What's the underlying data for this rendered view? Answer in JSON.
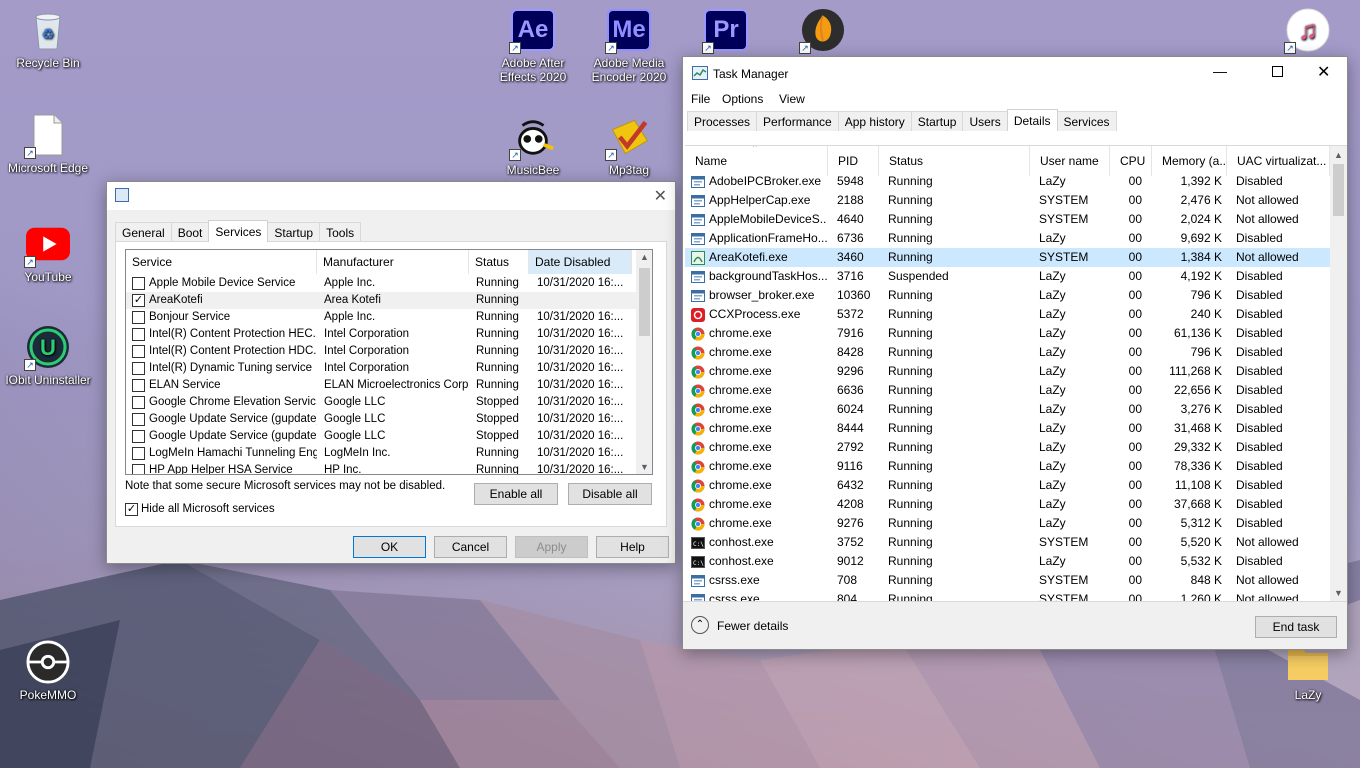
{
  "desktop": {
    "icons": [
      {
        "label": "Recycle Bin"
      },
      {
        "label": "Microsoft Edge"
      },
      {
        "label": "YouTube"
      },
      {
        "label": "IObit Uninstaller"
      },
      {
        "label": "PokeMMO"
      },
      {
        "label": "Adobe After Effects 2020",
        "glyph": "Ae"
      },
      {
        "label": "Adobe Media Encoder 2020",
        "glyph": "Me"
      },
      {
        "label": "Pr",
        "glyph": "Pr"
      },
      {
        "label": "MusicBee"
      },
      {
        "label": "Mp3tag"
      },
      {
        "label": "LaZy"
      }
    ]
  },
  "msconfig": {
    "tabs": [
      "General",
      "Boot",
      "Services",
      "Startup",
      "Tools"
    ],
    "active_tab": "Services",
    "columns": [
      "Service",
      "Manufacturer",
      "Status",
      "Date Disabled"
    ],
    "rows": [
      {
        "service": "Apple Mobile Device Service",
        "manufacturer": "Apple Inc.",
        "status": "Running",
        "date": "10/31/2020 16:...",
        "checked": false
      },
      {
        "service": "AreaKotefi",
        "manufacturer": "Area Kotefi",
        "status": "Running",
        "date": "",
        "checked": true
      },
      {
        "service": "Bonjour Service",
        "manufacturer": "Apple Inc.",
        "status": "Running",
        "date": "10/31/2020 16:...",
        "checked": false
      },
      {
        "service": "Intel(R) Content Protection HEC...",
        "manufacturer": "Intel Corporation",
        "status": "Running",
        "date": "10/31/2020 16:...",
        "checked": false
      },
      {
        "service": "Intel(R) Content Protection HDC...",
        "manufacturer": "Intel Corporation",
        "status": "Running",
        "date": "10/31/2020 16:...",
        "checked": false
      },
      {
        "service": "Intel(R) Dynamic Tuning service",
        "manufacturer": "Intel Corporation",
        "status": "Running",
        "date": "10/31/2020 16:...",
        "checked": false
      },
      {
        "service": "ELAN Service",
        "manufacturer": "ELAN Microelectronics Corp.",
        "status": "Running",
        "date": "10/31/2020 16:...",
        "checked": false
      },
      {
        "service": "Google Chrome Elevation Servic...",
        "manufacturer": "Google LLC",
        "status": "Stopped",
        "date": "10/31/2020 16:...",
        "checked": false
      },
      {
        "service": "Google Update Service (gupdate)",
        "manufacturer": "Google LLC",
        "status": "Stopped",
        "date": "10/31/2020 16:...",
        "checked": false
      },
      {
        "service": "Google Update Service (gupdatem)",
        "manufacturer": "Google LLC",
        "status": "Stopped",
        "date": "10/31/2020 16:...",
        "checked": false
      },
      {
        "service": "LogMeIn Hamachi Tunneling Engine",
        "manufacturer": "LogMeIn Inc.",
        "status": "Running",
        "date": "10/31/2020 16:...",
        "checked": false
      },
      {
        "service": "HP App Helper HSA Service",
        "manufacturer": "HP Inc.",
        "status": "Running",
        "date": "10/31/2020 16:...",
        "checked": false
      }
    ],
    "note": "Note that some secure Microsoft services may not be disabled.",
    "enable_all": "Enable all",
    "disable_all": "Disable all",
    "hide_ms_label": "Hide all Microsoft services",
    "hide_ms_checked": true,
    "ok": "OK",
    "cancel": "Cancel",
    "apply": "Apply",
    "help": "Help"
  },
  "task_manager": {
    "title": "Task Manager",
    "menu": [
      "File",
      "Options",
      "View"
    ],
    "tabs": [
      "Processes",
      "Performance",
      "App history",
      "Startup",
      "Users",
      "Details",
      "Services"
    ],
    "active_tab": "Details",
    "columns": [
      "Name",
      "PID",
      "Status",
      "User name",
      "CPU",
      "Memory (a...",
      "UAC virtualizat..."
    ],
    "rows": [
      {
        "name": "AdobeIPCBroker.exe",
        "pid": "5948",
        "status": "Running",
        "user": "LaZy",
        "cpu": "00",
        "mem": "1,392 K",
        "uac": "Disabled",
        "icon": "window-icon"
      },
      {
        "name": "AppHelperCap.exe",
        "pid": "2188",
        "status": "Running",
        "user": "SYSTEM",
        "cpu": "00",
        "mem": "2,476 K",
        "uac": "Not allowed",
        "icon": "window-icon"
      },
      {
        "name": "AppleMobileDeviceS...",
        "pid": "4640",
        "status": "Running",
        "user": "SYSTEM",
        "cpu": "00",
        "mem": "2,024 K",
        "uac": "Not allowed",
        "icon": "window-icon"
      },
      {
        "name": "ApplicationFrameHo...",
        "pid": "6736",
        "status": "Running",
        "user": "LaZy",
        "cpu": "00",
        "mem": "9,692 K",
        "uac": "Disabled",
        "icon": "window-icon"
      },
      {
        "name": "AreaKotefi.exe",
        "pid": "3460",
        "status": "Running",
        "user": "SYSTEM",
        "cpu": "00",
        "mem": "1,384 K",
        "uac": "Not allowed",
        "icon": "areakotefi-icon",
        "selected": true
      },
      {
        "name": "backgroundTaskHos...",
        "pid": "3716",
        "status": "Suspended",
        "user": "LaZy",
        "cpu": "00",
        "mem": "4,192 K",
        "uac": "Disabled",
        "icon": "window-icon"
      },
      {
        "name": "browser_broker.exe",
        "pid": "10360",
        "status": "Running",
        "user": "LaZy",
        "cpu": "00",
        "mem": "796 K",
        "uac": "Disabled",
        "icon": "window-icon"
      },
      {
        "name": "CCXProcess.exe",
        "pid": "5372",
        "status": "Running",
        "user": "LaZy",
        "cpu": "00",
        "mem": "240 K",
        "uac": "Disabled",
        "icon": "creative-cloud-icon"
      },
      {
        "name": "chrome.exe",
        "pid": "7916",
        "status": "Running",
        "user": "LaZy",
        "cpu": "00",
        "mem": "61,136 K",
        "uac": "Disabled",
        "icon": "chrome-icon"
      },
      {
        "name": "chrome.exe",
        "pid": "8428",
        "status": "Running",
        "user": "LaZy",
        "cpu": "00",
        "mem": "796 K",
        "uac": "Disabled",
        "icon": "chrome-icon"
      },
      {
        "name": "chrome.exe",
        "pid": "9296",
        "status": "Running",
        "user": "LaZy",
        "cpu": "00",
        "mem": "111,268 K",
        "uac": "Disabled",
        "icon": "chrome-icon"
      },
      {
        "name": "chrome.exe",
        "pid": "6636",
        "status": "Running",
        "user": "LaZy",
        "cpu": "00",
        "mem": "22,656 K",
        "uac": "Disabled",
        "icon": "chrome-icon"
      },
      {
        "name": "chrome.exe",
        "pid": "6024",
        "status": "Running",
        "user": "LaZy",
        "cpu": "00",
        "mem": "3,276 K",
        "uac": "Disabled",
        "icon": "chrome-icon"
      },
      {
        "name": "chrome.exe",
        "pid": "8444",
        "status": "Running",
        "user": "LaZy",
        "cpu": "00",
        "mem": "31,468 K",
        "uac": "Disabled",
        "icon": "chrome-icon"
      },
      {
        "name": "chrome.exe",
        "pid": "2792",
        "status": "Running",
        "user": "LaZy",
        "cpu": "00",
        "mem": "29,332 K",
        "uac": "Disabled",
        "icon": "chrome-icon"
      },
      {
        "name": "chrome.exe",
        "pid": "9116",
        "status": "Running",
        "user": "LaZy",
        "cpu": "00",
        "mem": "78,336 K",
        "uac": "Disabled",
        "icon": "chrome-icon"
      },
      {
        "name": "chrome.exe",
        "pid": "6432",
        "status": "Running",
        "user": "LaZy",
        "cpu": "00",
        "mem": "11,108 K",
        "uac": "Disabled",
        "icon": "chrome-icon"
      },
      {
        "name": "chrome.exe",
        "pid": "4208",
        "status": "Running",
        "user": "LaZy",
        "cpu": "00",
        "mem": "37,668 K",
        "uac": "Disabled",
        "icon": "chrome-icon"
      },
      {
        "name": "chrome.exe",
        "pid": "9276",
        "status": "Running",
        "user": "LaZy",
        "cpu": "00",
        "mem": "5,312 K",
        "uac": "Disabled",
        "icon": "chrome-icon"
      },
      {
        "name": "conhost.exe",
        "pid": "3752",
        "status": "Running",
        "user": "SYSTEM",
        "cpu": "00",
        "mem": "5,520 K",
        "uac": "Not allowed",
        "icon": "console-icon"
      },
      {
        "name": "conhost.exe",
        "pid": "9012",
        "status": "Running",
        "user": "LaZy",
        "cpu": "00",
        "mem": "5,532 K",
        "uac": "Disabled",
        "icon": "console-icon"
      },
      {
        "name": "csrss.exe",
        "pid": "708",
        "status": "Running",
        "user": "SYSTEM",
        "cpu": "00",
        "mem": "848 K",
        "uac": "Not allowed",
        "icon": "window-icon"
      },
      {
        "name": "csrss.exe",
        "pid": "804",
        "status": "Running",
        "user": "SYSTEM",
        "cpu": "00",
        "mem": "1,260 K",
        "uac": "Not allowed",
        "icon": "window-icon"
      }
    ],
    "fewer_details": "Fewer details",
    "end_task": "End task"
  },
  "colors": {
    "selection": "#cce8ff",
    "adobe_ae": "#9999ff",
    "adobe_me": "#8f8fff",
    "adobe_pr": "#9999ff",
    "adobe_bg": "#00005b"
  }
}
